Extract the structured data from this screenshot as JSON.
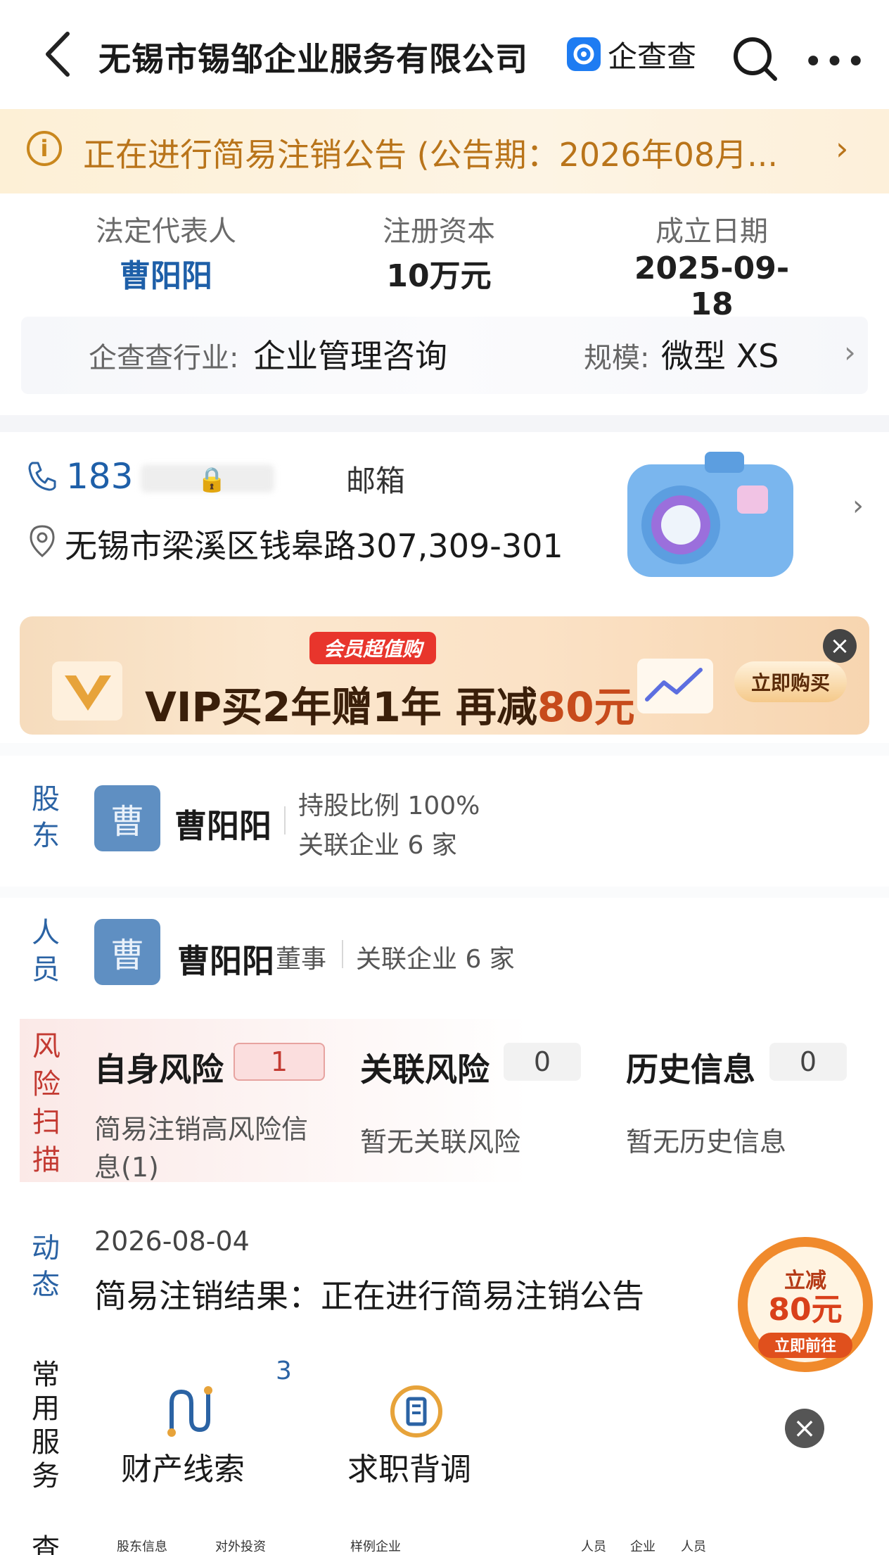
{
  "header": {
    "title": "无锡市锡邹企业服务有限公司",
    "brand": "企查查"
  },
  "notice": {
    "text": "正在进行简易注销公告 (公告期：2026年08月..."
  },
  "key_info": {
    "legal_rep_label": "法定代表人",
    "legal_rep_value": "曹阳阳",
    "capital_label": "注册资本",
    "capital_value": "10万元",
    "founded_label": "成立日期",
    "founded_value": "2025-09-18"
  },
  "industry": {
    "label": "企查查行业:",
    "value": "企业管理咨询",
    "scale_label": "规模:",
    "scale_value": "微型 XS"
  },
  "contact": {
    "phone": "183",
    "email_label": "邮箱",
    "address": "无锡市梁溪区钱皋路307,309-301"
  },
  "vip_banner": {
    "badge": "会员超值购",
    "main_prefix": "VIP买2年赠1年  再减",
    "main_amount": "80元",
    "buy_button": "立即购买"
  },
  "shareholder": {
    "side_label": "股东",
    "avatar": "曹",
    "name": "曹阳阳",
    "ratio": "持股比例 100%",
    "related": "关联企业 6 家"
  },
  "personnel": {
    "side_label": "人员",
    "avatar": "曹",
    "name": "曹阳阳",
    "role": "董事",
    "related": "关联企业 6 家"
  },
  "risk": {
    "side_label": "风险扫描",
    "items": [
      {
        "title": "自身风险",
        "count": "1",
        "desc": "简易注销高风险信息(1)"
      },
      {
        "title": "关联风险",
        "count": "0",
        "desc": "暂无关联风险"
      },
      {
        "title": "历史信息",
        "count": "0",
        "desc": "暂无历史信息"
      }
    ]
  },
  "dynamics": {
    "side_label": "动态",
    "date": "2026-08-04",
    "text": "简易注销结果：正在进行简易注销公告"
  },
  "coupon": {
    "line1": "立减",
    "line2": "80元",
    "line3": "立即前往"
  },
  "services": {
    "side_label": "常用服务",
    "badge": "3",
    "items": [
      {
        "label": "财产线索",
        "icon": "property-clue-icon"
      },
      {
        "label": "求职背调",
        "icon": "job-check-icon"
      }
    ]
  },
  "bottom_tabs": {
    "side_label": "查",
    "items": [
      "股东信息",
      "对外投资",
      "样例企业",
      "人员",
      "企业",
      "人员"
    ]
  },
  "colors": {
    "accent_blue": "#1e5fa8",
    "notice_orange": "#b9741a",
    "risk_red": "#c33a32"
  }
}
